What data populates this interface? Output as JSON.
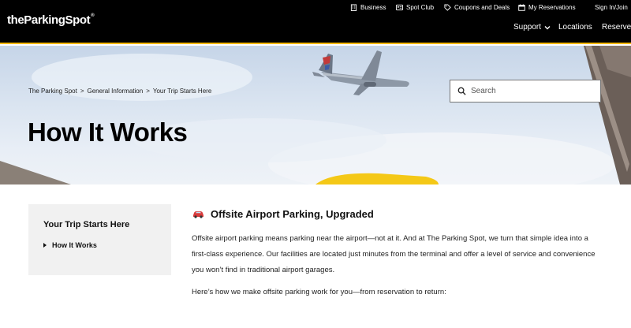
{
  "brand": {
    "name": "theParkingSpot",
    "reg_mark": "®"
  },
  "utility_nav": {
    "business": "Business",
    "spot_club": "Spot Club",
    "coupons": "Coupons and Deals",
    "reservations": "My Reservations",
    "sign_in": "Sign In/Join"
  },
  "main_nav": {
    "support": "Support",
    "locations": "Locations",
    "reserve": "Reserve"
  },
  "breadcrumb": [
    "The Parking Spot",
    ">",
    "General Information",
    ">",
    "Your Trip Starts Here"
  ],
  "hero": {
    "title": "How It Works"
  },
  "search": {
    "placeholder": "Search"
  },
  "sidebar": {
    "title": "Your Trip Starts Here",
    "items": [
      {
        "label": "How It Works",
        "active": true
      }
    ]
  },
  "content": {
    "heading_icon": "car-icon",
    "heading": "Offsite Airport Parking, Upgraded",
    "paragraphs": [
      "Offsite airport parking means parking near the airport—not at it. And at The Parking Spot, we turn that simple idea into a first-class experience. Our facilities are located just minutes from the terminal and offer a level of service and convenience you won’t find in traditional airport garages.",
      "Here’s how we make offsite parking work for you—from reservation to return:"
    ]
  },
  "colors": {
    "nav_bg": "#000000",
    "accent": "#f5b900",
    "sidebar_bg": "#f1f1f1",
    "car_red": "#d93a3a"
  }
}
